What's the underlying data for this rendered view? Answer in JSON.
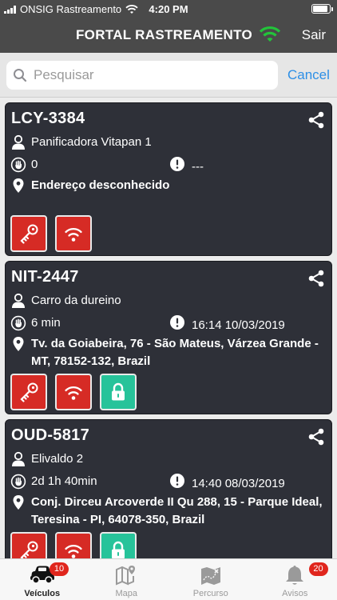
{
  "status_bar": {
    "carrier": "ONSIG Rastreamento",
    "time": "4:20 PM",
    "battery_level": 0.9
  },
  "app_bar": {
    "title": "FORTAL RASTREAMENTO",
    "logout_label": "Sair",
    "signal_color": "#22c43a"
  },
  "search": {
    "placeholder": "Pesquisar",
    "value": "",
    "cancel_label": "Cancel"
  },
  "vehicles": [
    {
      "plate": "LCY-3384",
      "driver": "Panificadora Vitapan 1",
      "stopped_time": "0",
      "alarm": "---",
      "address": "Endereço desconhecido",
      "actions": [
        "key",
        "signal"
      ]
    },
    {
      "plate": "NIT-2447",
      "driver": "Carro da dureino",
      "stopped_time": "6 min",
      "alarm": "16:14 10/03/2019",
      "address": "Tv. da Goiabeira, 76 - São Mateus, Várzea Grande - MT, 78152-132, Brazil",
      "actions": [
        "key",
        "signal",
        "lock"
      ]
    },
    {
      "plate": "OUD-5817",
      "driver": "Elivaldo 2",
      "stopped_time": "2d 1h 40min",
      "alarm": "14:40 08/03/2019",
      "address": "Conj. Dirceu Arcoverde II Qu 288, 15 - Parque Ideal, Teresina - PI, 64078-350, Brazil",
      "actions": [
        "key",
        "signal",
        "lock"
      ]
    }
  ],
  "tabs": [
    {
      "label": "Veículos",
      "icon": "car-icon",
      "badge": "10",
      "active": true
    },
    {
      "label": "Mapa",
      "icon": "map-icon",
      "badge": "",
      "active": false
    },
    {
      "label": "Percurso",
      "icon": "route-map-icon",
      "badge": "",
      "active": false
    },
    {
      "label": "Avisos",
      "icon": "bell-icon",
      "badge": "20",
      "active": false
    }
  ],
  "colors": {
    "header": "#4a4a4a",
    "card": "#2e3038",
    "action_red": "#d62b25",
    "action_green": "#27c39a",
    "link_blue": "#2d8fe6",
    "badge_red": "#e0261d"
  }
}
